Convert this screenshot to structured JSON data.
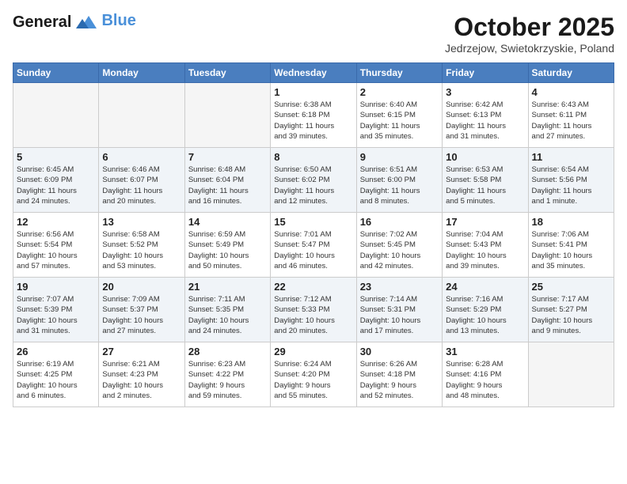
{
  "header": {
    "logo_general": "General",
    "logo_blue": "Blue",
    "month_title": "October 2025",
    "subtitle": "Jedrzejow, Swietokrzyskie, Poland"
  },
  "days_of_week": [
    "Sunday",
    "Monday",
    "Tuesday",
    "Wednesday",
    "Thursday",
    "Friday",
    "Saturday"
  ],
  "weeks": [
    [
      {
        "day": "",
        "info": ""
      },
      {
        "day": "",
        "info": ""
      },
      {
        "day": "",
        "info": ""
      },
      {
        "day": "1",
        "info": "Sunrise: 6:38 AM\nSunset: 6:18 PM\nDaylight: 11 hours\nand 39 minutes."
      },
      {
        "day": "2",
        "info": "Sunrise: 6:40 AM\nSunset: 6:15 PM\nDaylight: 11 hours\nand 35 minutes."
      },
      {
        "day": "3",
        "info": "Sunrise: 6:42 AM\nSunset: 6:13 PM\nDaylight: 11 hours\nand 31 minutes."
      },
      {
        "day": "4",
        "info": "Sunrise: 6:43 AM\nSunset: 6:11 PM\nDaylight: 11 hours\nand 27 minutes."
      }
    ],
    [
      {
        "day": "5",
        "info": "Sunrise: 6:45 AM\nSunset: 6:09 PM\nDaylight: 11 hours\nand 24 minutes."
      },
      {
        "day": "6",
        "info": "Sunrise: 6:46 AM\nSunset: 6:07 PM\nDaylight: 11 hours\nand 20 minutes."
      },
      {
        "day": "7",
        "info": "Sunrise: 6:48 AM\nSunset: 6:04 PM\nDaylight: 11 hours\nand 16 minutes."
      },
      {
        "day": "8",
        "info": "Sunrise: 6:50 AM\nSunset: 6:02 PM\nDaylight: 11 hours\nand 12 minutes."
      },
      {
        "day": "9",
        "info": "Sunrise: 6:51 AM\nSunset: 6:00 PM\nDaylight: 11 hours\nand 8 minutes."
      },
      {
        "day": "10",
        "info": "Sunrise: 6:53 AM\nSunset: 5:58 PM\nDaylight: 11 hours\nand 5 minutes."
      },
      {
        "day": "11",
        "info": "Sunrise: 6:54 AM\nSunset: 5:56 PM\nDaylight: 11 hours\nand 1 minute."
      }
    ],
    [
      {
        "day": "12",
        "info": "Sunrise: 6:56 AM\nSunset: 5:54 PM\nDaylight: 10 hours\nand 57 minutes."
      },
      {
        "day": "13",
        "info": "Sunrise: 6:58 AM\nSunset: 5:52 PM\nDaylight: 10 hours\nand 53 minutes."
      },
      {
        "day": "14",
        "info": "Sunrise: 6:59 AM\nSunset: 5:49 PM\nDaylight: 10 hours\nand 50 minutes."
      },
      {
        "day": "15",
        "info": "Sunrise: 7:01 AM\nSunset: 5:47 PM\nDaylight: 10 hours\nand 46 minutes."
      },
      {
        "day": "16",
        "info": "Sunrise: 7:02 AM\nSunset: 5:45 PM\nDaylight: 10 hours\nand 42 minutes."
      },
      {
        "day": "17",
        "info": "Sunrise: 7:04 AM\nSunset: 5:43 PM\nDaylight: 10 hours\nand 39 minutes."
      },
      {
        "day": "18",
        "info": "Sunrise: 7:06 AM\nSunset: 5:41 PM\nDaylight: 10 hours\nand 35 minutes."
      }
    ],
    [
      {
        "day": "19",
        "info": "Sunrise: 7:07 AM\nSunset: 5:39 PM\nDaylight: 10 hours\nand 31 minutes."
      },
      {
        "day": "20",
        "info": "Sunrise: 7:09 AM\nSunset: 5:37 PM\nDaylight: 10 hours\nand 27 minutes."
      },
      {
        "day": "21",
        "info": "Sunrise: 7:11 AM\nSunset: 5:35 PM\nDaylight: 10 hours\nand 24 minutes."
      },
      {
        "day": "22",
        "info": "Sunrise: 7:12 AM\nSunset: 5:33 PM\nDaylight: 10 hours\nand 20 minutes."
      },
      {
        "day": "23",
        "info": "Sunrise: 7:14 AM\nSunset: 5:31 PM\nDaylight: 10 hours\nand 17 minutes."
      },
      {
        "day": "24",
        "info": "Sunrise: 7:16 AM\nSunset: 5:29 PM\nDaylight: 10 hours\nand 13 minutes."
      },
      {
        "day": "25",
        "info": "Sunrise: 7:17 AM\nSunset: 5:27 PM\nDaylight: 10 hours\nand 9 minutes."
      }
    ],
    [
      {
        "day": "26",
        "info": "Sunrise: 6:19 AM\nSunset: 4:25 PM\nDaylight: 10 hours\nand 6 minutes."
      },
      {
        "day": "27",
        "info": "Sunrise: 6:21 AM\nSunset: 4:23 PM\nDaylight: 10 hours\nand 2 minutes."
      },
      {
        "day": "28",
        "info": "Sunrise: 6:23 AM\nSunset: 4:22 PM\nDaylight: 9 hours\nand 59 minutes."
      },
      {
        "day": "29",
        "info": "Sunrise: 6:24 AM\nSunset: 4:20 PM\nDaylight: 9 hours\nand 55 minutes."
      },
      {
        "day": "30",
        "info": "Sunrise: 6:26 AM\nSunset: 4:18 PM\nDaylight: 9 hours\nand 52 minutes."
      },
      {
        "day": "31",
        "info": "Sunrise: 6:28 AM\nSunset: 4:16 PM\nDaylight: 9 hours\nand 48 minutes."
      },
      {
        "day": "",
        "info": ""
      }
    ]
  ]
}
